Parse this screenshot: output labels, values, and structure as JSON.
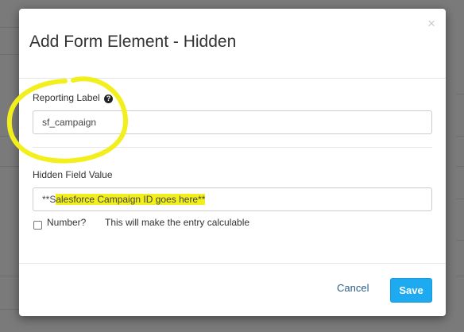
{
  "modal": {
    "title": "Add Form Element - Hidden",
    "close_symbol": "×"
  },
  "fields": {
    "reporting_label": {
      "label": "Reporting Label",
      "value": "sf_campaign",
      "help_icon": "question-circle-icon"
    },
    "hidden_value": {
      "label": "Hidden Field Value",
      "value_prefix": "**S",
      "value_highlighted": "alesforce Campaign ID goes here**",
      "highlight_color": "#f2ef1d"
    },
    "number": {
      "label": "Number?",
      "help_text": "This will make the entry calculable",
      "checked": false
    }
  },
  "footer": {
    "cancel_label": "Cancel",
    "save_label": "Save",
    "save_color": "#1eaaf1"
  },
  "annotation": {
    "type": "circle",
    "color": "#f2ef1d"
  }
}
